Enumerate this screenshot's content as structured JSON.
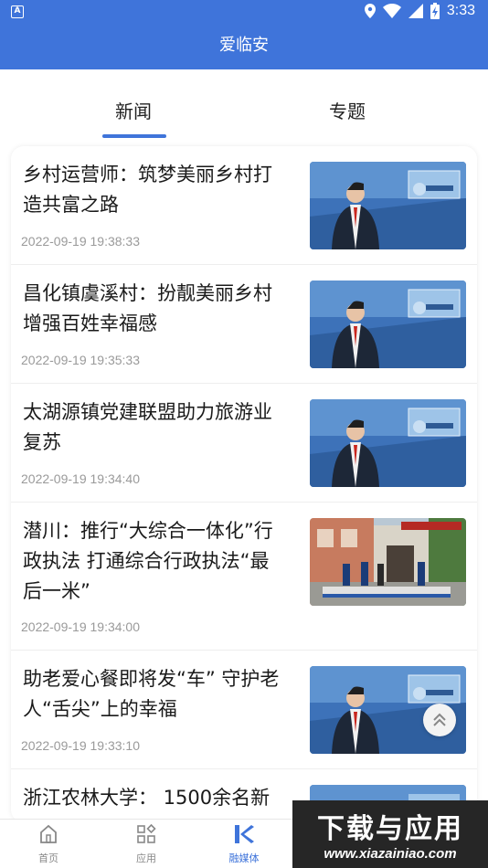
{
  "status_bar": {
    "time": "3:33",
    "left_icon": "a-app-icon",
    "icons": [
      "location-icon",
      "wifi-icon",
      "signal-icon",
      "battery-charging-icon"
    ]
  },
  "app_bar": {
    "title": "爱临安"
  },
  "tabs": [
    {
      "label": "新闻",
      "active": true
    },
    {
      "label": "专题",
      "active": false
    }
  ],
  "news": [
    {
      "title": "乡村运营师：筑梦美丽乡村打造共富之路",
      "time": "2022-09-19 19:38:33",
      "thumb": "anchor-studio"
    },
    {
      "title": "昌化镇虞溪村：扮靓美丽乡村 增强百姓幸福感",
      "time": "2022-09-19 19:35:33",
      "thumb": "anchor-studio"
    },
    {
      "title": "太湖源镇党建联盟助力旅游业复苏",
      "time": "2022-09-19 19:34:40",
      "thumb": "anchor-studio"
    },
    {
      "title": "潜川：推行“大综合一体化”行政执法 打通综合行政执法“最后一米”",
      "time": "2022-09-19 19:34:00",
      "thumb": "street-scene"
    },
    {
      "title": "助老爱心餐即将发“车” 守护老人“舌尖”上的幸福",
      "time": "2022-09-19 19:33:10",
      "thumb": "anchor-studio"
    },
    {
      "title": "浙江农林大学： 1500余名新",
      "time": "",
      "thumb": "anchor-studio"
    }
  ],
  "bottom_nav": [
    {
      "label": "首页",
      "icon": "home-icon",
      "active": false
    },
    {
      "label": "应用",
      "icon": "apps-grid-icon",
      "active": false
    },
    {
      "label": "融媒体",
      "icon": "media-logo-icon",
      "active": true
    }
  ],
  "watermark": {
    "title": "下载与应用",
    "url": "www.xiazainiao.com"
  },
  "colors": {
    "primary": "#3f74da",
    "text": "#1a1a1a",
    "meta": "#9a9a9a"
  }
}
